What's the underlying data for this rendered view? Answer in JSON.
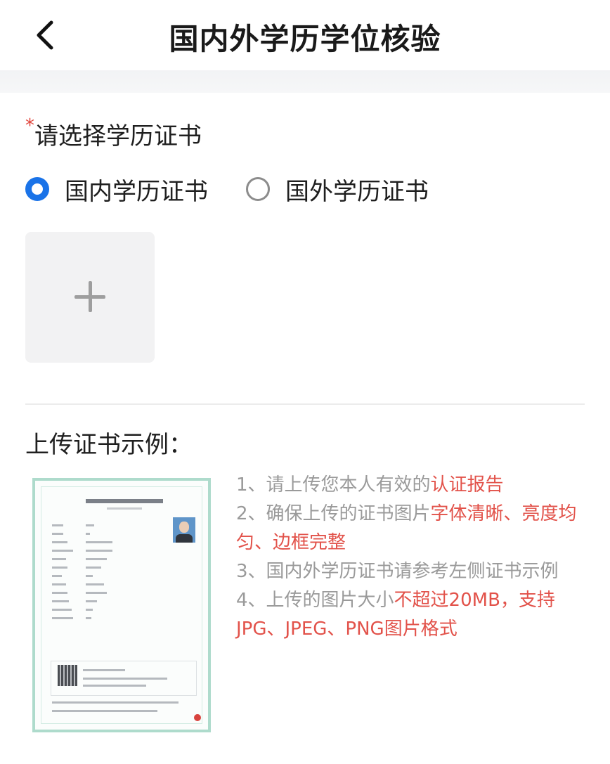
{
  "header": {
    "title": "国内外学历学位核验",
    "back_icon": "chevron-left-icon"
  },
  "form": {
    "required_mark": "*",
    "label": "请选择学历证书",
    "options": [
      {
        "label": "国内学历证书",
        "selected": true
      },
      {
        "label": "国外学历证书",
        "selected": false
      }
    ],
    "upload_icon": "plus-icon"
  },
  "example": {
    "title": "上传证书示例："
  },
  "notes": [
    {
      "prefix": "1、请上传您本人有效的",
      "highlight": "认证报告"
    },
    {
      "prefix": "2、确保上传的证书图片",
      "highlight": "字体清晰、亮度均匀、边框完整"
    },
    {
      "prefix": "3、国内外学历证书请参考左侧证书示例",
      "highlight": ""
    },
    {
      "prefix": "4、上传的图片大小",
      "highlight": "不超过20MB，支持JPG、JPEG、PNG图片格式"
    }
  ],
  "colors": {
    "accent": "#1a73e8",
    "highlight": "#e2524a",
    "required": "#e0443c"
  }
}
